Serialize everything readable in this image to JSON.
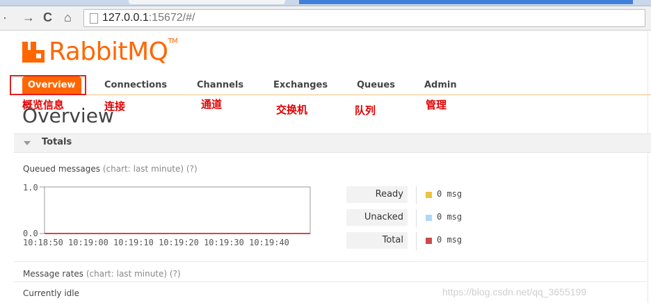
{
  "browser": {
    "back_icon": "back-arrow-icon",
    "forward_icon": "forward-arrow-icon",
    "reload_icon": "reload-icon",
    "home_icon": "home-icon",
    "url_host": "127.0.0.1",
    "url_rest": ":15672/#/"
  },
  "logo": {
    "text": "RabbitMQ",
    "tm": "TM"
  },
  "nav": {
    "items": [
      {
        "label": "Overview",
        "active": true
      },
      {
        "label": "Connections"
      },
      {
        "label": "Channels"
      },
      {
        "label": "Exchanges"
      },
      {
        "label": "Queues"
      },
      {
        "label": "Admin"
      }
    ]
  },
  "annotations": [
    "概览信息",
    "连接",
    "通道",
    "交换机",
    "队列",
    "管理"
  ],
  "page_title": "Overview",
  "totals_section": {
    "title": "Totals"
  },
  "queued_messages": {
    "label": "Queued messages",
    "hint": "(chart: last minute) (?)"
  },
  "chart_data": {
    "type": "line",
    "y_labels": [
      "1.0",
      "0.0"
    ],
    "ylim": [
      0,
      1
    ],
    "x_labels": [
      "10:18:50",
      "10:19:00",
      "10:19:10",
      "10:19:20",
      "10:19:30",
      "10:19:40"
    ],
    "x_label_text": "10:18:50 10:19:00 10:19:10 10:19:20 10:19:30 10:19:40",
    "series": [
      {
        "name": "Ready",
        "color": "#edc240",
        "values": [
          0,
          0,
          0,
          0,
          0,
          0
        ]
      },
      {
        "name": "Unacked",
        "color": "#afd8f8",
        "values": [
          0,
          0,
          0,
          0,
          0,
          0
        ]
      },
      {
        "name": "Total",
        "color": "#cb4b4b",
        "values": [
          0,
          0,
          0,
          0,
          0,
          0
        ]
      }
    ]
  },
  "legend": [
    {
      "label": "Ready",
      "value": "0 msg",
      "color": "#edc240"
    },
    {
      "label": "Unacked",
      "value": "0 msg",
      "color": "#afd8f8"
    },
    {
      "label": "Total",
      "value": "0 msg",
      "color": "#cb4b4b"
    }
  ],
  "message_rates": {
    "label": "Message rates",
    "hint": "(chart: last minute) (?)"
  },
  "status": "Currently idle",
  "watermark": "https://blog.csdn.net/qq_3655199"
}
